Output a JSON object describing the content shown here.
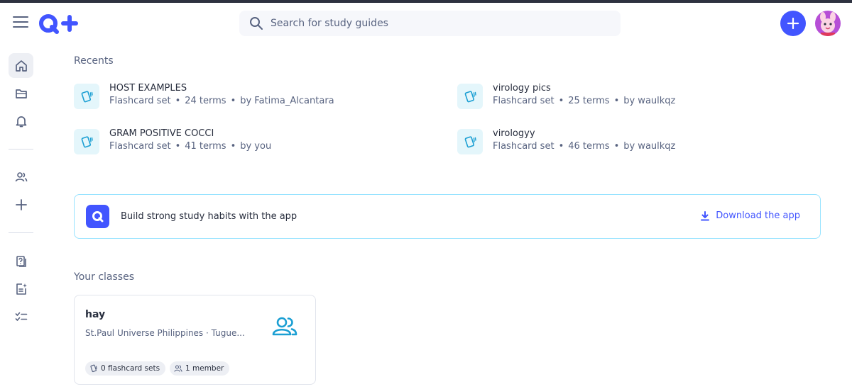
{
  "search": {
    "placeholder": "Search for study guides"
  },
  "sidebar": {
    "items": [
      {
        "name": "home"
      },
      {
        "name": "folders"
      },
      {
        "name": "notifications"
      },
      {
        "name": "classes"
      },
      {
        "name": "create"
      },
      {
        "name": "practice-tests"
      },
      {
        "name": "expert-solutions"
      },
      {
        "name": "checklist"
      }
    ]
  },
  "recents": {
    "title": "Recents",
    "items": [
      {
        "title": "HOST EXAMPLES",
        "type": "Flashcard set",
        "terms": "24 terms",
        "author": "by Fatima_Alcantara"
      },
      {
        "title": "virology pics",
        "type": "Flashcard set",
        "terms": "25 terms",
        "author": "by waulkqz"
      },
      {
        "title": "GRAM POSITIVE COCCI",
        "type": "Flashcard set",
        "terms": "41 terms",
        "author": "by you"
      },
      {
        "title": "virologyy",
        "type": "Flashcard set",
        "terms": "46 terms",
        "author": "by waulkqz"
      }
    ],
    "separator": "•"
  },
  "banner": {
    "text": "Build strong study habits with the app",
    "download_label": "Download the app"
  },
  "classes": {
    "title": "Your classes",
    "items": [
      {
        "name": "hay",
        "school": "St.Paul Universe Philippines · Tugue...",
        "sets": "0 flashcard sets",
        "members": "1 member"
      }
    ]
  },
  "colors": {
    "accent": "#4255ff",
    "text": "#282e3e",
    "muted": "#586380",
    "set_icon": "#1b9fd3",
    "banner_border": "#98e3ff"
  }
}
